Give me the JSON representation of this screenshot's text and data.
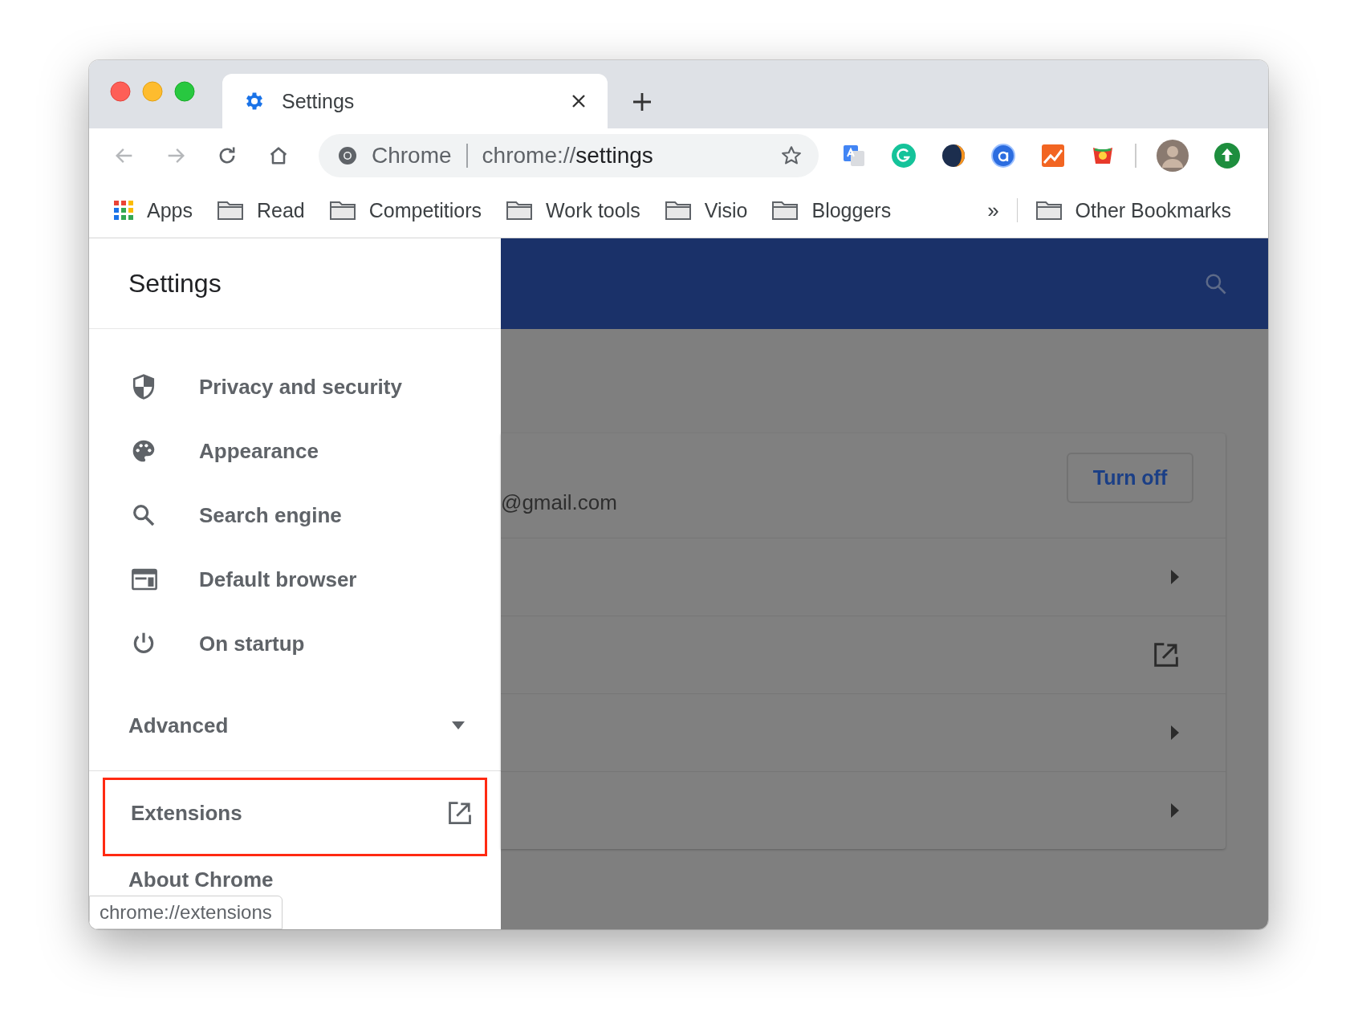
{
  "tab": {
    "title": "Settings"
  },
  "omnibox": {
    "site_label": "Chrome",
    "url_prefix": "chrome://",
    "url_host": "settings"
  },
  "bookmarks": [
    {
      "label": "Apps",
      "kind": "apps"
    },
    {
      "label": "Read",
      "kind": "folder"
    },
    {
      "label": "Competitiors",
      "kind": "folder"
    },
    {
      "label": "Work tools",
      "kind": "folder"
    },
    {
      "label": "Visio",
      "kind": "folder"
    },
    {
      "label": "Bloggers",
      "kind": "folder"
    }
  ],
  "bookmarks_overflow": "»",
  "other_bookmarks": "Other Bookmarks",
  "sidebar": {
    "title": "Settings",
    "items": [
      {
        "label": "Privacy and security",
        "kind": "shield"
      },
      {
        "label": "Appearance",
        "kind": "palette"
      },
      {
        "label": "Search engine",
        "kind": "search"
      },
      {
        "label": "Default browser",
        "kind": "browser"
      },
      {
        "label": "On startup",
        "kind": "power"
      }
    ],
    "advanced": {
      "label": "Advanced",
      "expanded": false
    },
    "extensions": {
      "label": "Extensions",
      "highlighted": true
    },
    "about": "About Chrome"
  },
  "tooltip": "chrome://extensions",
  "main": {
    "account_email": "@gmail.com",
    "turn_off_button": "Turn off",
    "rows": [
      {
        "kind": "arrow"
      },
      {
        "kind": "external"
      },
      {
        "kind": "arrow"
      },
      {
        "kind": "arrow"
      }
    ]
  }
}
